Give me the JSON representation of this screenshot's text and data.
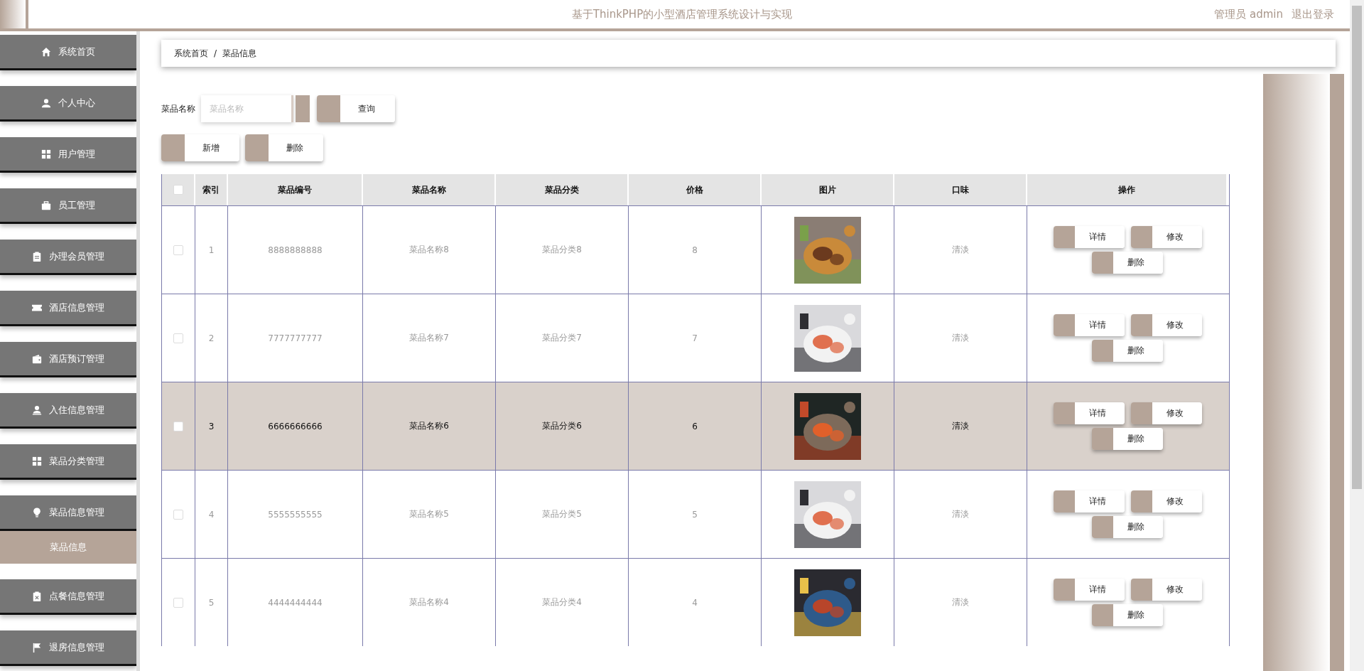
{
  "header": {
    "title": "基于ThinkPHP的小型酒店管理系统设计与实现",
    "user": "管理员 admin",
    "logout": "退出登录"
  },
  "sidebar": {
    "items": [
      {
        "label": "系统首页",
        "kind": "home",
        "expanded": false
      },
      {
        "label": "个人中心",
        "kind": "user",
        "expanded": false
      },
      {
        "label": "用户管理",
        "kind": "grid",
        "expanded": false
      },
      {
        "label": "员工管理",
        "kind": "case",
        "expanded": false
      },
      {
        "label": "办理会员管理",
        "kind": "clipboard",
        "expanded": false
      },
      {
        "label": "酒店信息管理",
        "kind": "ticket",
        "expanded": false
      },
      {
        "label": "酒店预订管理",
        "kind": "wallet",
        "expanded": false
      },
      {
        "label": "入住信息管理",
        "kind": "person",
        "expanded": false
      },
      {
        "label": "菜品分类管理",
        "kind": "grid",
        "expanded": false
      },
      {
        "label": "菜品信息管理",
        "kind": "bulb",
        "expanded": true,
        "children": [
          {
            "label": "菜品信息",
            "selected": true
          }
        ]
      },
      {
        "label": "点餐信息管理",
        "kind": "clipx",
        "expanded": false
      },
      {
        "label": "退房信息管理",
        "kind": "flag",
        "expanded": false
      }
    ]
  },
  "breadcrumb": [
    "系统首页",
    "/",
    "菜品信息"
  ],
  "search": {
    "label": "菜品名称",
    "placeholder": "菜品名称",
    "button": "查询"
  },
  "toolbar": [
    "新增",
    "删除"
  ],
  "table": {
    "header_checked": false,
    "columns": [
      "索引",
      "菜品编号",
      "菜品名称",
      "菜品分类",
      "价格",
      "图片",
      "口味",
      "操作"
    ],
    "rows": [
      {
        "index": "1",
        "code": "8888888888",
        "name": "菜品名称8",
        "category": "菜品分类8",
        "price": "8",
        "taste": "清淡",
        "checked": false,
        "selected": false,
        "actions": [
          "详情",
          "修改",
          "删除"
        ]
      },
      {
        "index": "2",
        "code": "7777777777",
        "name": "菜品名称7",
        "category": "菜品分类7",
        "price": "7",
        "taste": "清淡",
        "checked": false,
        "selected": false,
        "actions": [
          "详情",
          "修改",
          "删除"
        ]
      },
      {
        "index": "3",
        "code": "6666666666",
        "name": "菜品名称6",
        "category": "菜品分类6",
        "price": "6",
        "taste": "清淡",
        "checked": false,
        "selected": true,
        "actions": [
          "详情",
          "修改",
          "删除"
        ]
      },
      {
        "index": "4",
        "code": "5555555555",
        "name": "菜品名称5",
        "category": "菜品分类5",
        "price": "5",
        "taste": "清淡",
        "checked": false,
        "selected": false,
        "actions": [
          "详情",
          "修改",
          "删除"
        ]
      },
      {
        "index": "5",
        "code": "4444444444",
        "name": "菜品名称4",
        "category": "菜品分类4",
        "price": "4",
        "taste": "清淡",
        "checked": false,
        "selected": false,
        "actions": [
          "详情",
          "修改",
          "删除"
        ]
      }
    ]
  }
}
